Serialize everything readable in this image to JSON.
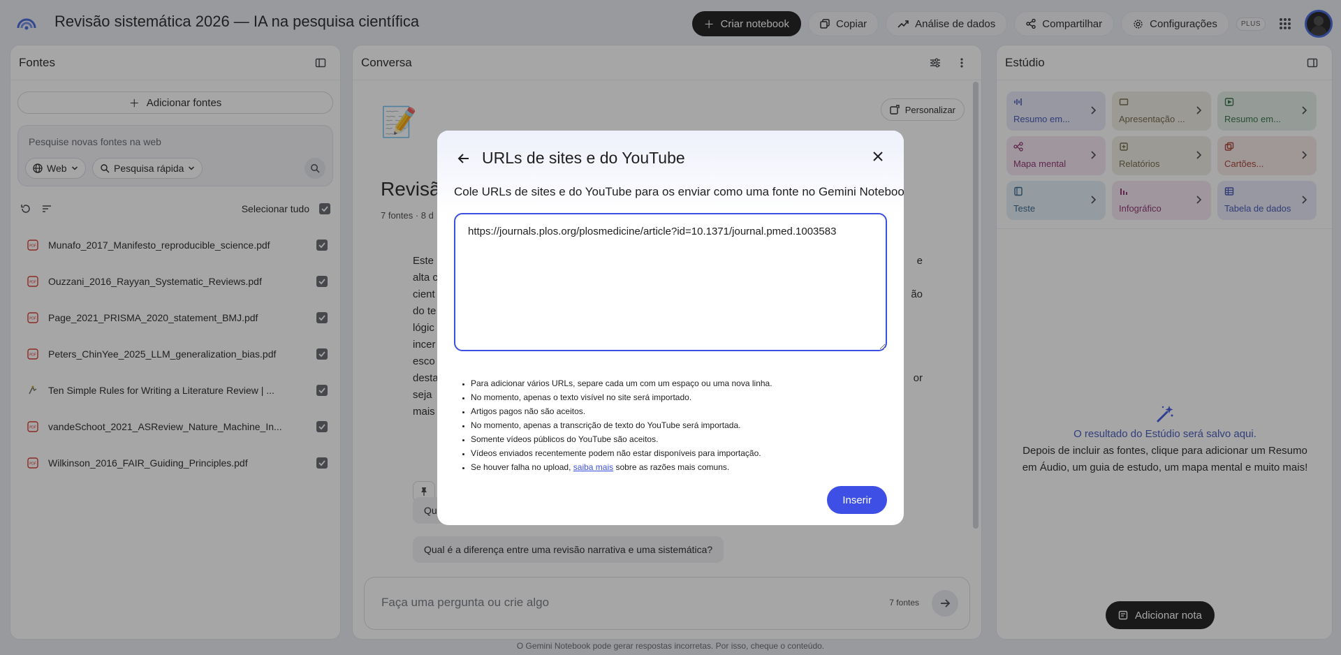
{
  "app": {
    "title": "Revisão sistemática 2026 — IA na pesquisa científica",
    "actions": {
      "create_notebook": "Criar notebook",
      "copy": "Copiar",
      "data_analysis": "Análise de dados",
      "share": "Compartilhar",
      "settings": "Configurações",
      "plan_badge": "PLUS"
    }
  },
  "sources": {
    "title": "Fontes",
    "add_button": "Adicionar fontes",
    "search_placeholder": "Pesquise novas fontes na web",
    "chip_web": "Web",
    "chip_quick": "Pesquisa rápida",
    "select_all": "Selecionar tudo",
    "items": [
      {
        "name": "Munafo_2017_Manifesto_reproducible_science.pdf",
        "type": "pdf"
      },
      {
        "name": "Ouzzani_2016_Rayyan_Systematic_Reviews.pdf",
        "type": "pdf"
      },
      {
        "name": "Page_2021_PRISMA_2020_statement_BMJ.pdf",
        "type": "pdf"
      },
      {
        "name": "Peters_ChinYee_2025_LLM_generalization_bias.pdf",
        "type": "pdf"
      },
      {
        "name": "Ten Simple Rules for Writing a Literature Review | ...",
        "type": "web"
      },
      {
        "name": "vandeSchoot_2021_ASReview_Nature_Machine_In...",
        "type": "pdf"
      },
      {
        "name": "Wilkinson_2016_FAIR_Guiding_Principles.pdf",
        "type": "pdf"
      }
    ]
  },
  "conversation": {
    "title": "Conversa",
    "personalize": "Personalizar",
    "notebook_title_partial": "Revisão",
    "notebook_meta_partial": "7 fontes · 8 d",
    "summary_fragments": [
      {
        "left": "Este",
        "right": "e"
      },
      {
        "left": "alta c",
        "right": ""
      },
      {
        "left": "cient",
        "right": "ão"
      },
      {
        "left": "do te",
        "right": ""
      },
      {
        "left": "lógic",
        "right": ""
      },
      {
        "left": "incer",
        "right": ""
      },
      {
        "left": "esco",
        "right": ""
      },
      {
        "left": "desta",
        "right": "or"
      },
      {
        "left": "seja",
        "right": ""
      },
      {
        "left": "mais",
        "right": ""
      }
    ],
    "suggestion_1_partial": "Qu",
    "suggestion_2": "Qual é a diferença entre uma revisão narrativa e uma sistemática?",
    "ask_placeholder": "Faça uma pergunta ou crie algo",
    "ask_source_count": "7 fontes"
  },
  "studio": {
    "title": "Estúdio",
    "cards": [
      {
        "label": "Resumo em...",
        "icon": "audio-waveform-icon",
        "bg": "#e6e8f6",
        "fg": "#3c4fb0"
      },
      {
        "label": "Apresentação ...",
        "icon": "slides-icon",
        "bg": "#efece0",
        "fg": "#6b6140"
      },
      {
        "label": "Resumo em...",
        "icon": "video-icon",
        "bg": "#e3efe6",
        "fg": "#2f6b3f"
      },
      {
        "label": "Mapa mental",
        "icon": "mindmap-icon",
        "bg": "#f3e6ef",
        "fg": "#8a2a6b"
      },
      {
        "label": "Relatórios",
        "icon": "report-icon",
        "bg": "#efece0",
        "fg": "#6b6140"
      },
      {
        "label": "Cartões...",
        "icon": "flashcards-icon",
        "bg": "#f6e7e5",
        "fg": "#a33a2a"
      },
      {
        "label": "Teste",
        "icon": "quiz-icon",
        "bg": "#e3eef5",
        "fg": "#2a5f86"
      },
      {
        "label": "Infográfico",
        "icon": "infographic-icon",
        "bg": "#f3e6ef",
        "fg": "#8a2a6b"
      },
      {
        "label": "Tabela de dados",
        "icon": "table-icon",
        "bg": "#e6e8f6",
        "fg": "#3c4fb0"
      }
    ],
    "empty_title": "O resultado do Estúdio será salvo aqui.",
    "empty_desc": "Depois de incluir as fontes, clique para adicionar um Resumo em Áudio, um guia de estudo, um mapa mental e muito mais!",
    "add_note": "Adicionar nota"
  },
  "footer": "O Gemini Notebook pode gerar respostas incorretas. Por isso, cheque o conteúdo.",
  "modal": {
    "title": "URLs de sites e do YouTube",
    "description": "Cole URLs de sites e do YouTube para os enviar como uma fonte no Gemini Notebook.",
    "url_value": "https://journals.plos.org/plosmedicine/article?id=10.1371/journal.pmed.1003583",
    "tips": [
      "Para adicionar vários URLs, separe cada um com um espaço ou uma nova linha.",
      "No momento, apenas o texto visível no site será importado.",
      "Artigos pagos não são aceitos.",
      "No momento, apenas a transcrição de texto do YouTube será importada.",
      "Somente vídeos públicos do YouTube são aceitos.",
      "Vídeos enviados recentemente podem não estar disponíveis para importação."
    ],
    "tip_last_prefix": "Se houver falha no upload, ",
    "tip_last_link": "saiba mais",
    "tip_last_suffix": " sobre as razões mais comuns.",
    "insert_button": "Inserir"
  },
  "colors": {
    "accent": "#3d4fe5",
    "dark_button": "#141414",
    "overlay": "#202124"
  }
}
